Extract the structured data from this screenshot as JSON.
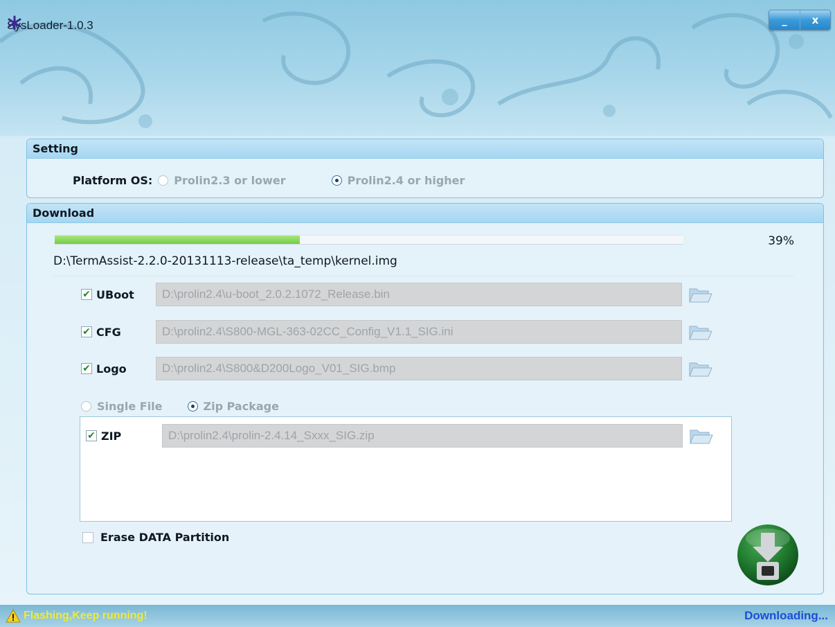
{
  "app": {
    "title": "SysLoader-1.0.3",
    "minimize_label": "_",
    "close_label": "x"
  },
  "setting": {
    "header": "Setting",
    "platform_label": "Platform OS:",
    "options": [
      {
        "label": "Prolin2.3 or lower",
        "selected": false
      },
      {
        "label": "Prolin2.4 or higher",
        "selected": true
      }
    ]
  },
  "download": {
    "header": "Download",
    "progress_percent": 39,
    "progress_text": "39%",
    "current_file": "D:\\TermAssist-2.2.0-20131113-release\\ta_temp\\kernel.img",
    "files": [
      {
        "label": "UBoot",
        "checked": true,
        "path": "D:\\prolin2.4\\u-boot_2.0.2.1072_Release.bin"
      },
      {
        "label": "CFG",
        "checked": true,
        "path": "D:\\prolin2.4\\S800-MGL-363-02CC_Config_V1.1_SIG.ini"
      },
      {
        "label": "Logo",
        "checked": true,
        "path": "D:\\prolin2.4\\S800&D200Logo_V01_SIG.bmp"
      }
    ],
    "mode_options": [
      {
        "label": "Single File",
        "selected": false
      },
      {
        "label": "Zip Package",
        "selected": true
      }
    ],
    "zip": {
      "label": "ZIP",
      "checked": true,
      "path": "D:\\prolin2.4\\prolin-2.4.14_Sxxx_SIG.zip"
    },
    "erase_label": "Erase DATA Partition",
    "erase_checked": false
  },
  "status": {
    "left_text": "Flashing,Keep running!",
    "right_text": "Downloading..."
  },
  "colors": {
    "progress_fill": "#73cc45",
    "status_warning_text": "#f4ea2c",
    "status_right_text": "#1a4fd6",
    "download_button": "#1f7a2e"
  },
  "icons": {
    "app_logo": "asterisk-app-icon",
    "warning": "warning-icon",
    "folder": "folder-open-icon",
    "download": "download-to-device-icon"
  }
}
